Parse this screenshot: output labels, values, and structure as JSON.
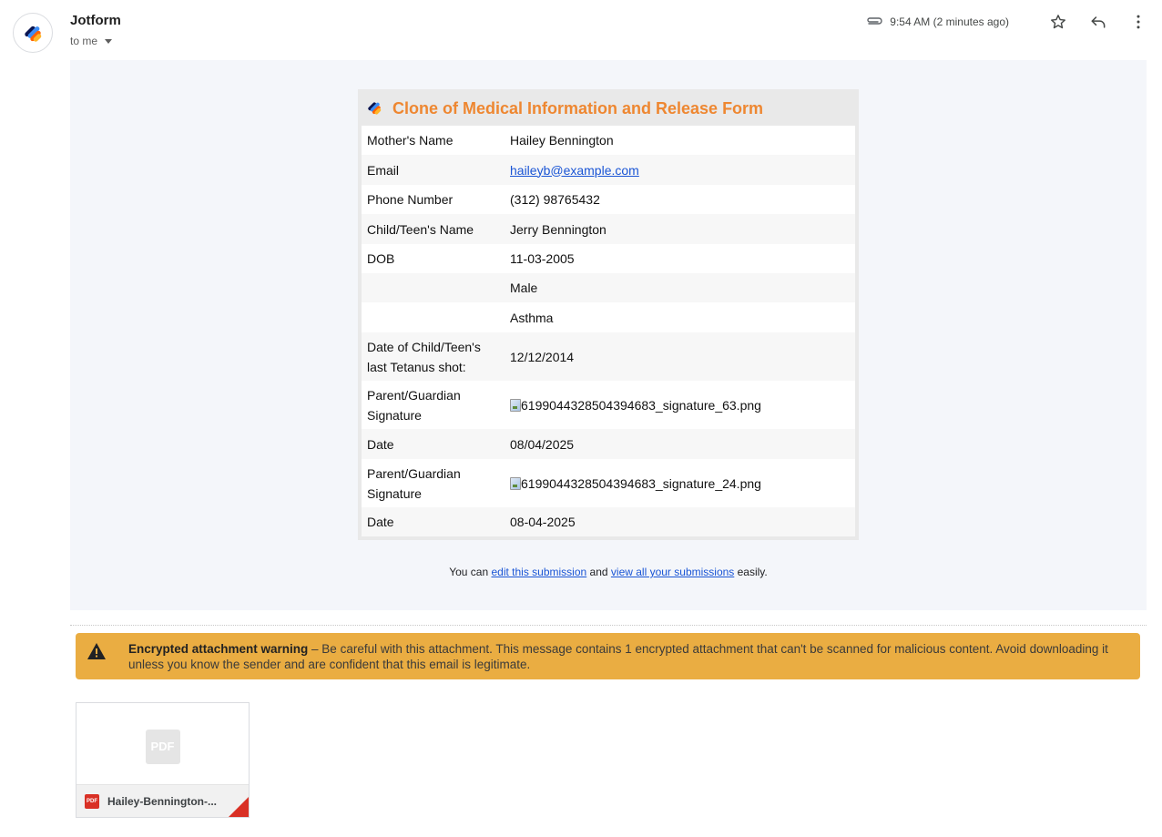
{
  "header": {
    "sender": "Jotform",
    "recipient": "to me",
    "time": "9:54 AM (2 minutes ago)"
  },
  "form": {
    "title": "Clone of Medical Information and Release Form",
    "rows": [
      {
        "label": "Mother's Name",
        "value": "Hailey Bennington"
      },
      {
        "label": "Email",
        "value": "haileyb@example.com"
      },
      {
        "label": "Phone Number",
        "value": "(312) 98765432"
      },
      {
        "label": "Child/Teen's Name",
        "value": "Jerry Bennington"
      },
      {
        "label": "DOB",
        "value": "11-03-2005"
      },
      {
        "label": "",
        "value": "Male"
      },
      {
        "label": "",
        "value": "Asthma"
      },
      {
        "label_line1": "Date of Child/Teen's",
        "label_line2": "last Tetanus shot:",
        "value": "12/12/2014"
      },
      {
        "label_line1": "Parent/Guardian",
        "label_line2": "Signature",
        "value": "6199044328504394683_signature_63.png"
      },
      {
        "label": "Date",
        "value": "08/04/2025"
      },
      {
        "label_line1": "Parent/Guardian",
        "label_line2": "Signature",
        "value": "6199044328504394683_signature_24.png"
      },
      {
        "label": "Date",
        "value": "08-04-2025"
      }
    ]
  },
  "footer": {
    "prefix": "You can ",
    "edit_link": "edit this submission",
    "middle": " and ",
    "view_link": "view all your submissions",
    "suffix": " easily."
  },
  "warning": {
    "title": "Encrypted attachment warning",
    "message": " – Be careful with this attachment. This message contains 1 encrypted attachment that can't be scanned for malicious content. Avoid downloading it unless you know the sender and are confident that this email is legitimate."
  },
  "attachment": {
    "type_label": "PDF",
    "name": "Hailey-Bennington-..."
  },
  "colors": {
    "title_orange": "#ee8731",
    "warning_bg": "#eaad42",
    "link_blue": "#1a55d5"
  }
}
